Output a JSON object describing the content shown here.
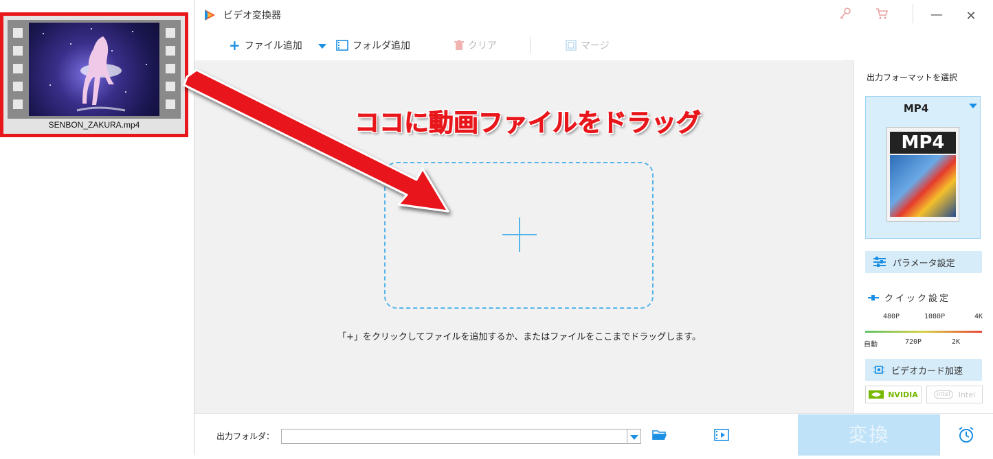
{
  "desktop_file": {
    "name": "SENBON_ZAKURA.mp4"
  },
  "window": {
    "title": "ビデオ変換器"
  },
  "toolbar": {
    "add_file": "ファイル追加",
    "add_folder": "フォルダ追加",
    "clear": "クリア",
    "merge": "マージ"
  },
  "main": {
    "drag_hint": "ココに動画ファイルをドラッグ",
    "instruction": "「+」をクリックしてファイルを追加するか、またはファイルをここまでドラッグします。"
  },
  "right_panel": {
    "format_label": "出力フォーマットを選択",
    "format_selected": "MP4",
    "format_icon_text": "MP4",
    "param_settings": "パラメータ設定",
    "quick_settings": "クイック設定",
    "quick_ticks_top": [
      "480P",
      "1080P",
      "4K"
    ],
    "quick_ticks_bottom": [
      "自動",
      "720P",
      "2K"
    ],
    "gpu_accel": "ビデオカード加速",
    "gpu_nvidia": "NVIDIA",
    "gpu_intel": "Intel"
  },
  "bottom": {
    "output_folder_label": "出力フォルダ：",
    "output_folder_value": "",
    "convert": "変換"
  },
  "colors": {
    "accent": "#1a8fe3",
    "annotation_red": "#e8171b",
    "dashed": "#55b4ea"
  },
  "icons": [
    "plus-icon",
    "folder-film-icon",
    "trash-icon",
    "merge-icon",
    "key-icon",
    "cart-icon",
    "minimize-icon",
    "close-icon",
    "sliders-icon",
    "chip-icon",
    "folder-open-icon",
    "video-folder-icon",
    "alarm-clock-icon"
  ]
}
